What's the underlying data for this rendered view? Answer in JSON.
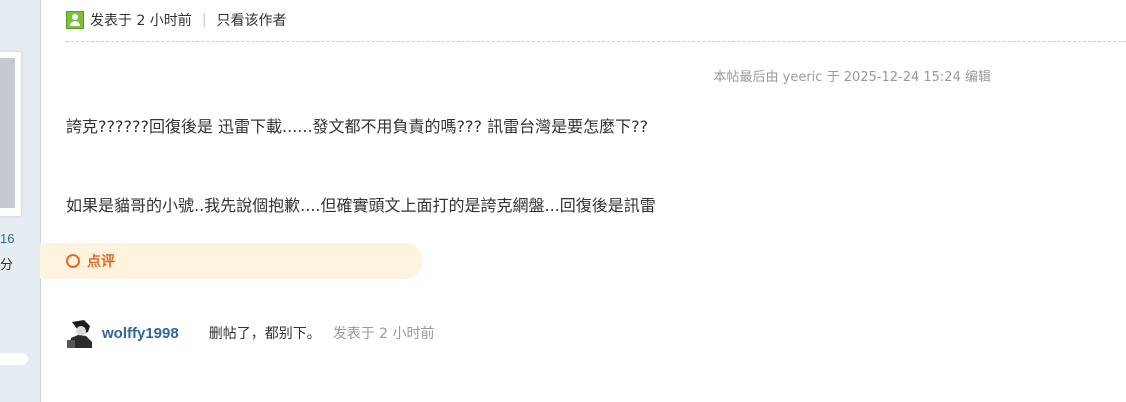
{
  "sidebar": {
    "stat_number": "16",
    "stat_label": "分"
  },
  "post": {
    "posted_label": "发表于 2 小时前",
    "separator": "|",
    "author_only_label": "只看该作者",
    "edit_note": "本帖最后由 yeeric 于 2025-12-24 15:24 编辑",
    "content_line_1": "誇克??????回復後是 迅雷下載......發文都不用負責的嗎???  訊雷台灣是要怎麼下??",
    "content_line_2": "如果是貓哥的小號..我先說個抱歉....但確實頭文上面打的是誇克網盤...回復後是訊雷"
  },
  "comments": {
    "label": "点评",
    "items": [
      {
        "author": "wolffy1998",
        "text": "删帖了，都别下。",
        "time": "发表于 2 小时前"
      }
    ]
  },
  "colors": {
    "accent_orange": "#e66a25",
    "comment_bg": "#fef3df",
    "link_blue": "#336699",
    "online_green": "#7cc03b"
  }
}
